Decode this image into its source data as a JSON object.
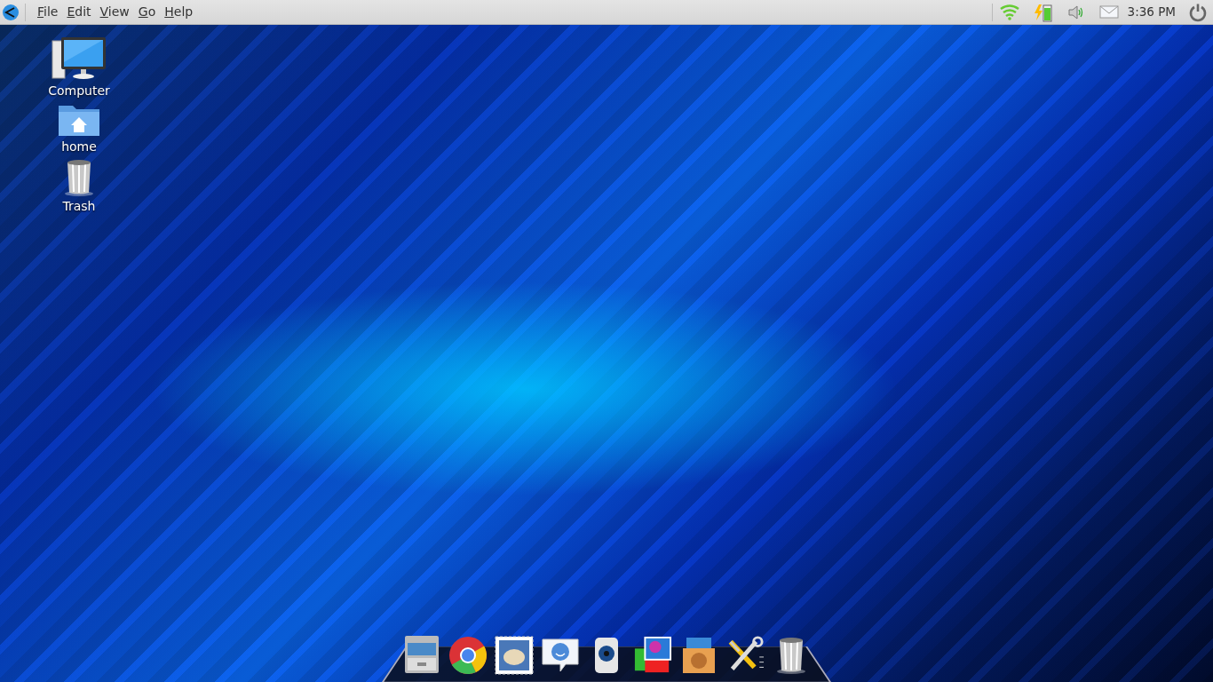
{
  "top_panel": {
    "menu": [
      {
        "label": "File"
      },
      {
        "label": "Edit"
      },
      {
        "label": "View"
      },
      {
        "label": "Go"
      },
      {
        "label": "Help"
      }
    ],
    "tray": [
      {
        "kind": "wifi"
      },
      {
        "kind": "battery"
      },
      {
        "kind": "volume"
      },
      {
        "kind": "mail"
      }
    ],
    "clock": "3:36 PM"
  },
  "desktop_icons": [
    {
      "kind": "computer",
      "label": "Computer"
    },
    {
      "kind": "folder",
      "label": "home"
    },
    {
      "kind": "trash",
      "label": "Trash"
    }
  ],
  "dock": [
    {
      "kind": "files"
    },
    {
      "kind": "browser"
    },
    {
      "kind": "mail"
    },
    {
      "kind": "chat"
    },
    {
      "kind": "speaker"
    },
    {
      "kind": "photos"
    },
    {
      "kind": "store"
    },
    {
      "kind": "tools"
    },
    {
      "kind": "trash"
    }
  ]
}
